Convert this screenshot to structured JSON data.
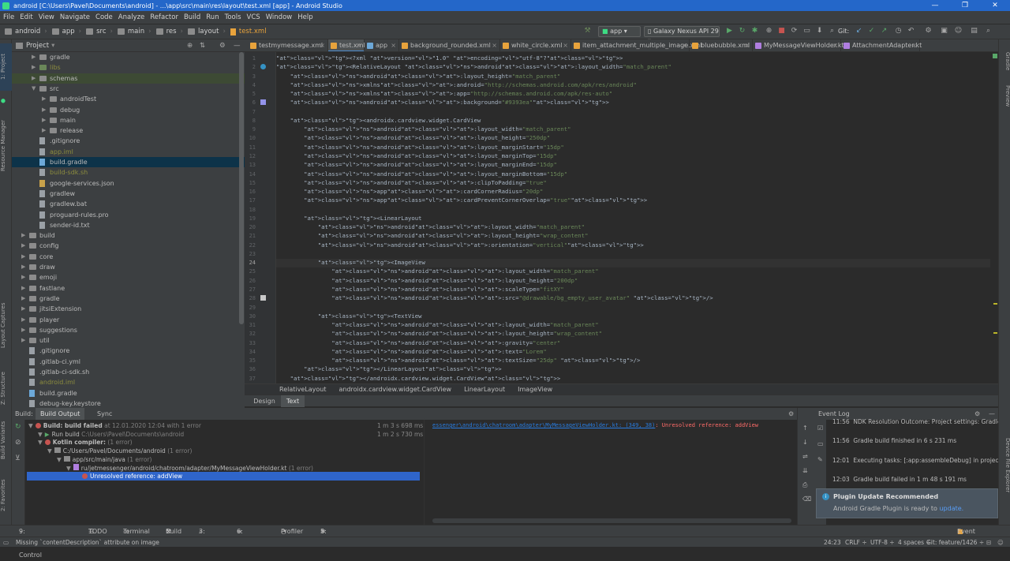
{
  "title": "android [C:\\Users\\Pavel\\Documents\\android] - ...\\app\\src\\main\\res\\layout\\test.xml [app] - Android Studio",
  "window_controls": [
    "—",
    "❐",
    "✕"
  ],
  "menu": [
    "File",
    "Edit",
    "View",
    "Navigate",
    "Code",
    "Analyze",
    "Refactor",
    "Build",
    "Run",
    "Tools",
    "VCS",
    "Window",
    "Help"
  ],
  "breadcrumb": [
    "android",
    "app",
    "src",
    "main",
    "res",
    "layout",
    "test.xml"
  ],
  "run_config": "app",
  "device": "Galaxy Nexus API 29",
  "git_label": "Git:",
  "left_strip": [
    "1: Project",
    "Resource Manager",
    "Layout Captures",
    "Z: Structure",
    "Build Variants",
    "2: Favorites"
  ],
  "right_strip": [
    "Gradle",
    "Preview",
    "Device File Explorer"
  ],
  "project_panel": {
    "title": "Project",
    "tree": [
      {
        "label": "gradle",
        "indent": 1,
        "kind": "folder",
        "arrow": "▶",
        "color": "#bbbbbb"
      },
      {
        "label": "libs",
        "indent": 1,
        "kind": "folder",
        "arrow": "▶",
        "color": "#8c8c3e"
      },
      {
        "label": "schemas",
        "indent": 1,
        "kind": "folder",
        "arrow": "▶",
        "color": "#bbbbbb",
        "bg": "#3d4a34"
      },
      {
        "label": "src",
        "indent": 1,
        "kind": "folder",
        "arrow": "▼",
        "color": "#bbbbbb"
      },
      {
        "label": "androidTest",
        "indent": 2,
        "kind": "folder",
        "arrow": "▶",
        "color": "#bbbbbb"
      },
      {
        "label": "debug",
        "indent": 2,
        "kind": "folder",
        "arrow": "▶",
        "color": "#bbbbbb"
      },
      {
        "label": "main",
        "indent": 2,
        "kind": "folder",
        "arrow": "▶",
        "color": "#bbbbbb"
      },
      {
        "label": "release",
        "indent": 2,
        "kind": "folder",
        "arrow": "▶",
        "color": "#bbbbbb"
      },
      {
        "label": ".gitignore",
        "indent": 1,
        "kind": "file",
        "arrow": "",
        "color": "#bbbbbb"
      },
      {
        "label": "app.iml",
        "indent": 1,
        "kind": "file",
        "arrow": "",
        "color": "#8c8c3e"
      },
      {
        "label": "build.gradle",
        "indent": 1,
        "kind": "gradle",
        "arrow": "",
        "color": "#bbbbbb",
        "bg": "#0d3349"
      },
      {
        "label": "build-sdk.sh",
        "indent": 1,
        "kind": "file",
        "arrow": "",
        "color": "#8c8c3e"
      },
      {
        "label": "google-services.json",
        "indent": 1,
        "kind": "json",
        "arrow": "",
        "color": "#bbbbbb"
      },
      {
        "label": "gradlew",
        "indent": 1,
        "kind": "file",
        "arrow": "",
        "color": "#bbbbbb"
      },
      {
        "label": "gradlew.bat",
        "indent": 1,
        "kind": "file",
        "arrow": "",
        "color": "#bbbbbb"
      },
      {
        "label": "proguard-rules.pro",
        "indent": 1,
        "kind": "file",
        "arrow": "",
        "color": "#bbbbbb"
      },
      {
        "label": "sender-id.txt",
        "indent": 1,
        "kind": "file",
        "arrow": "",
        "color": "#bbbbbb"
      },
      {
        "label": "build",
        "indent": 0,
        "kind": "folder",
        "arrow": "▶",
        "color": "#bbbbbb"
      },
      {
        "label": "config",
        "indent": 0,
        "kind": "folder",
        "arrow": "▶",
        "color": "#bbbbbb"
      },
      {
        "label": "core",
        "indent": 0,
        "kind": "folder",
        "arrow": "▶",
        "color": "#bbbbbb"
      },
      {
        "label": "draw",
        "indent": 0,
        "kind": "folder",
        "arrow": "▶",
        "color": "#bbbbbb"
      },
      {
        "label": "emoji",
        "indent": 0,
        "kind": "folder",
        "arrow": "▶",
        "color": "#bbbbbb"
      },
      {
        "label": "fastlane",
        "indent": 0,
        "kind": "folder",
        "arrow": "▶",
        "color": "#bbbbbb"
      },
      {
        "label": "gradle",
        "indent": 0,
        "kind": "folder",
        "arrow": "▶",
        "color": "#bbbbbb"
      },
      {
        "label": "jitsiExtension",
        "indent": 0,
        "kind": "folder",
        "arrow": "▶",
        "color": "#bbbbbb"
      },
      {
        "label": "player",
        "indent": 0,
        "kind": "folder",
        "arrow": "▶",
        "color": "#bbbbbb"
      },
      {
        "label": "suggestions",
        "indent": 0,
        "kind": "folder",
        "arrow": "▶",
        "color": "#bbbbbb"
      },
      {
        "label": "util",
        "indent": 0,
        "kind": "folder",
        "arrow": "▶",
        "color": "#bbbbbb"
      },
      {
        "label": ".gitignore",
        "indent": 0,
        "kind": "file",
        "arrow": "",
        "color": "#bbbbbb"
      },
      {
        "label": ".gitlab-ci.yml",
        "indent": 0,
        "kind": "file",
        "arrow": "",
        "color": "#bbbbbb"
      },
      {
        "label": ".gitlab-ci-sdk.sh",
        "indent": 0,
        "kind": "file",
        "arrow": "",
        "color": "#bbbbbb"
      },
      {
        "label": "android.iml",
        "indent": 0,
        "kind": "file",
        "arrow": "",
        "color": "#8c8c3e"
      },
      {
        "label": "build.gradle",
        "indent": 0,
        "kind": "gradle",
        "arrow": "",
        "color": "#bbbbbb"
      },
      {
        "label": "debug-key.keystore",
        "indent": 0,
        "kind": "file",
        "arrow": "",
        "color": "#bbbbbb"
      }
    ]
  },
  "tabs": [
    {
      "label": "testmymessage.xml",
      "color": "#e8a33c",
      "active": false
    },
    {
      "label": "test.xml",
      "color": "#e8a33c",
      "active": true
    },
    {
      "label": "app",
      "color": "#6ca8d8",
      "active": false
    },
    {
      "label": "background_rounded.xml",
      "color": "#e8a33c",
      "active": false
    },
    {
      "label": "white_circle.xml",
      "color": "#e8a33c",
      "active": false
    },
    {
      "label": "item_attachment_multiple_image.xml",
      "color": "#e8a33c",
      "active": false
    },
    {
      "label": "bluebubble.xml",
      "color": "#e8a33c",
      "active": false
    },
    {
      "label": "MyMessageViewHolder.kt",
      "color": "#b07ee0",
      "active": false
    },
    {
      "label": "AttachmentAdapter.kt",
      "color": "#b07ee0",
      "active": false
    }
  ],
  "code_lines": [
    "<?xml version=\"1.0\" encoding=\"utf-8\"?>",
    "<RelativeLayout android:layout_width=\"match_parent\"",
    "    android:layout_height=\"match_parent\"",
    "    xmlns:android=\"http://schemas.android.com/apk/res/android\"",
    "    xmlns:app=\"http://schemas.android.com/apk/res-auto\"",
    "    android:background=\"#9393ea\">",
    "",
    "    <androidx.cardview.widget.CardView",
    "        android:layout_width=\"match_parent\"",
    "        android:layout_height=\"250dp\"",
    "        android:layout_marginStart=\"15dp\"",
    "        android:layout_marginTop=\"15dp\"",
    "        android:layout_marginEnd=\"15dp\"",
    "        android:layout_marginBottom=\"15dp\"",
    "        android:clipToPadding=\"true\"",
    "        app:cardCornerRadius=\"20dp\"",
    "        app:cardPreventCornerOverlap=\"true\">",
    "",
    "        <LinearLayout",
    "            android:layout_width=\"match_parent\"",
    "            android:layout_height=\"wrap_content\"",
    "            android:orientation=\"vertical\">",
    "",
    "            <ImageView",
    "                android:layout_width=\"match_parent\"",
    "                android:layout_height=\"200dp\"",
    "                android:scaleType=\"fitXY\"",
    "                android:src=\"@drawable/bg_empty_user_avatar\" />",
    "",
    "            <TextView",
    "                android:layout_width=\"match_parent\"",
    "                android:layout_height=\"wrap_content\"",
    "                android:gravity=\"center\"",
    "                android:text=\"Lorem\"",
    "                android:textSize=\"25dp\" />",
    "        </LinearLayout>",
    "    </androidx.cardview.widget.CardView>"
  ],
  "editor_breadcrumb": [
    "RelativeLayout",
    "androidx.cardview.widget.CardView",
    "LinearLayout",
    "ImageView"
  ],
  "design_tabs": [
    "Design",
    "Text"
  ],
  "build_panel": {
    "label": "Build:",
    "tabs": [
      "Build Output",
      "Sync"
    ],
    "rows": [
      {
        "text": "Build: build failed",
        "extra": "at 12.01.2020 12:04  with 1 error",
        "time": "1 m 3 s 698 ms",
        "indent": 0,
        "icon": "err",
        "arrow": "▼"
      },
      {
        "text": "Run build",
        "extra": "C:\\Users\\Pavel\\Documents\\android",
        "time": "1 m 2 s 730 ms",
        "indent": 1,
        "icon": "ok",
        "arrow": "▼"
      },
      {
        "text": "Kotlin compiler:",
        "extra": "(1 error)",
        "time": "",
        "indent": 1,
        "icon": "err",
        "arrow": "▼"
      },
      {
        "text": "C:/Users/Pavel/Documents/android",
        "extra": "(1 error)",
        "time": "",
        "indent": 2,
        "icon": "folder",
        "arrow": "▼"
      },
      {
        "text": "app/src/main/java",
        "extra": "(1 error)",
        "time": "",
        "indent": 3,
        "icon": "folder",
        "arrow": "▼"
      },
      {
        "text": "ru/jetmessenger/android/chatroom/adapter/MyMessageViewHolder.kt",
        "extra": "(1 error)",
        "time": "",
        "indent": 4,
        "icon": "kt",
        "arrow": "▼"
      },
      {
        "text": "Unresolved reference: addView",
        "extra": "",
        "time": "",
        "indent": 5,
        "icon": "err",
        "arrow": ""
      }
    ],
    "output_link": "essenger\\android\\chatroom\\adapter\\MyMessageViewHolder.kt: (349, 38)",
    "output_msg": ": Unresolved reference: addView"
  },
  "event_log": {
    "title": "Event Log",
    "rows": [
      {
        "time": "11:56",
        "text": "NDK Resolution Outcome: Project settings: Gradle"
      },
      {
        "time": "11:56",
        "text": "Gradle build finished in 6 s 231 ms"
      },
      {
        "time": "12:01",
        "text": "Executing tasks: [:app:assembleDebug] in project C:\\U"
      },
      {
        "time": "12:03",
        "text": "Gradle build failed in 1 m 48 s 191 ms"
      },
      {
        "time": "12:03",
        "text": "Executing tasks: [:app:assembleDebug] in project C:\\U"
      }
    ],
    "notif_title": "Plugin Update Recommended",
    "notif_body": "Android Gradle Plugin is ready to ",
    "notif_link": "update."
  },
  "bottom_tabs": [
    "9: Version Control",
    "TODO",
    "Terminal",
    "Build",
    "3: Find",
    "6: Logcat",
    "Profiler",
    "5: Debug"
  ],
  "event_log_btn": "Event Log",
  "status": {
    "message": "Missing `contentDescription` attribute on image",
    "position": "24:23",
    "line_sep": "CRLF ÷",
    "encoding": "UTF-8 ÷",
    "indent": "4 spaces ÷",
    "git": "Git: feature/1426 ÷"
  }
}
